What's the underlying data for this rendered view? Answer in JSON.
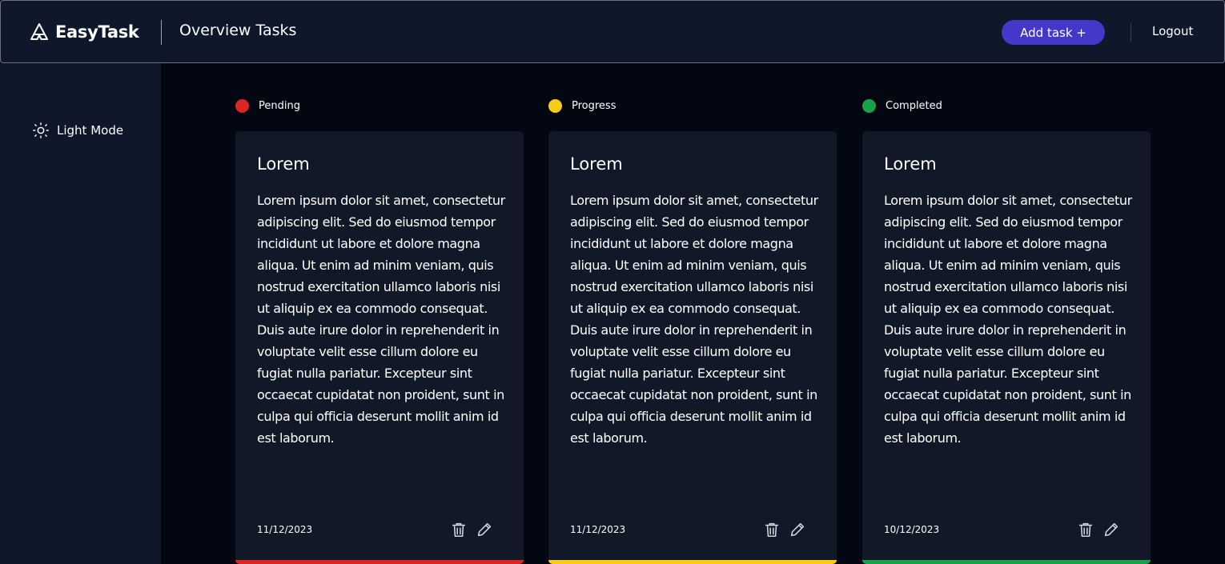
{
  "header": {
    "brand_name": "EasyTask",
    "page_title": "Overview Tasks",
    "add_task_label": "Add task +",
    "logout_label": "Logout"
  },
  "sidebar": {
    "theme_toggle_label": "Light Mode"
  },
  "colors": {
    "accent": "#4338ca",
    "pending": "#dc2626",
    "progress": "#facc15",
    "completed": "#16a34a"
  },
  "columns": [
    {
      "label": "Pending",
      "status_color": "#dc2626",
      "card": {
        "title": "Lorem",
        "body": "Lorem ipsum dolor sit amet, consectetur adipiscing elit. Sed do eiusmod tempor incididunt ut labore et dolore magna aliqua. Ut enim ad minim veniam, quis nostrud exercitation ullamco laboris nisi ut aliquip ex ea commodo consequat. Duis aute irure dolor in reprehenderit in voluptate velit esse cillum dolore eu fugiat nulla pariatur. Excepteur sint occaecat cupidatat non proident, sunt in culpa qui officia deserunt mollit anim id est laborum.",
        "date": "11/12/2023"
      }
    },
    {
      "label": "Progress",
      "status_color": "#facc15",
      "card": {
        "title": "Lorem",
        "body": "Lorem ipsum dolor sit amet, consectetur adipiscing elit. Sed do eiusmod tempor incididunt ut labore et dolore magna aliqua. Ut enim ad minim veniam, quis nostrud exercitation ullamco laboris nisi ut aliquip ex ea commodo consequat. Duis aute irure dolor in reprehenderit in voluptate velit esse cillum dolore eu fugiat nulla pariatur. Excepteur sint occaecat cupidatat non proident, sunt in culpa qui officia deserunt mollit anim id est laborum.",
        "date": "11/12/2023"
      }
    },
    {
      "label": "Completed",
      "status_color": "#16a34a",
      "card": {
        "title": "Lorem",
        "body": "Lorem ipsum dolor sit amet, consectetur adipiscing elit. Sed do eiusmod tempor incididunt ut labore et dolore magna aliqua. Ut enim ad minim veniam, quis nostrud exercitation ullamco laboris nisi ut aliquip ex ea commodo consequat. Duis aute irure dolor in reprehenderit in voluptate velit esse cillum dolore eu fugiat nulla pariatur. Excepteur sint occaecat cupidatat non proident, sunt in culpa qui officia deserunt mollit anim id est laborum.",
        "date": "10/12/2023"
      }
    }
  ]
}
